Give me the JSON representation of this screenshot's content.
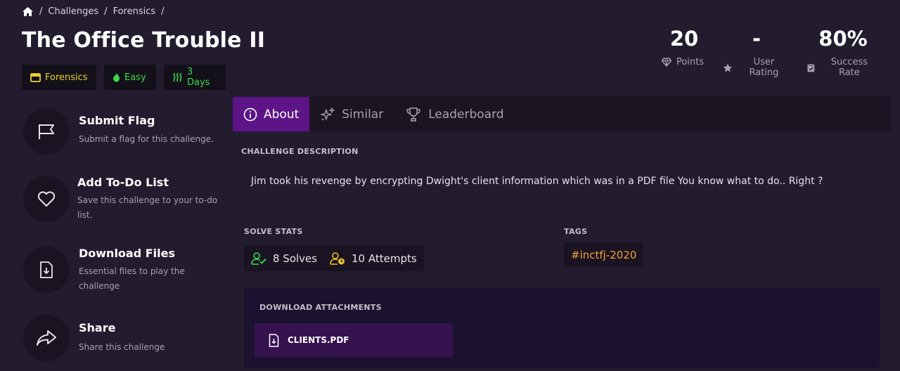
{
  "breadcrumb": {
    "items": [
      "Challenges",
      "Forensics"
    ],
    "separator": "/"
  },
  "challenge": {
    "title": "The Office Trouble II",
    "badges": {
      "category": "Forensics",
      "difficulty": "Easy",
      "age": "3 Days"
    }
  },
  "stats": {
    "points": {
      "value": "20",
      "label": "Points"
    },
    "rating": {
      "value": "-",
      "label": "User Rating"
    },
    "success": {
      "value": "80%",
      "label": "Success Rate"
    }
  },
  "actions": [
    {
      "title": "Submit Flag",
      "desc": "Submit a flag for this challenge.",
      "icon": "flag-icon"
    },
    {
      "title": "Add To-Do List",
      "desc": "Save this challenge to your to-do list.",
      "icon": "heart-icon"
    },
    {
      "title": "Download Files",
      "desc": "Essential files to play the challenge",
      "icon": "file-download-icon"
    },
    {
      "title": "Share",
      "desc": "Share this challenge",
      "icon": "share-icon"
    }
  ],
  "tabs": [
    {
      "label": "About",
      "active": true,
      "icon": "info-icon"
    },
    {
      "label": "Similar",
      "active": false,
      "icon": "sparkles-icon"
    },
    {
      "label": "Leaderboard",
      "active": false,
      "icon": "trophy-icon"
    }
  ],
  "about": {
    "description_label": "CHALLENGE DESCRIPTION",
    "description": "Jim took his revenge by encrypting Dwight's client information which was in a PDF file You know what to do.. Right ?",
    "solve_stats_label": "SOLVE STATS",
    "solves": "8 Solves",
    "attempts": "10 Attempts",
    "tags_label": "TAGS",
    "tags": [
      "#inctfj-2020"
    ],
    "attachments_label": "DOWNLOAD ATTACHMENTS",
    "file_name": "CLIENTS.PDF"
  },
  "colors": {
    "background": "#231b2e",
    "accent_purple": "#5c1487",
    "category_yellow": "#e8d130",
    "difficulty_green": "#3ad94a",
    "tag_orange": "#f0a23a"
  }
}
